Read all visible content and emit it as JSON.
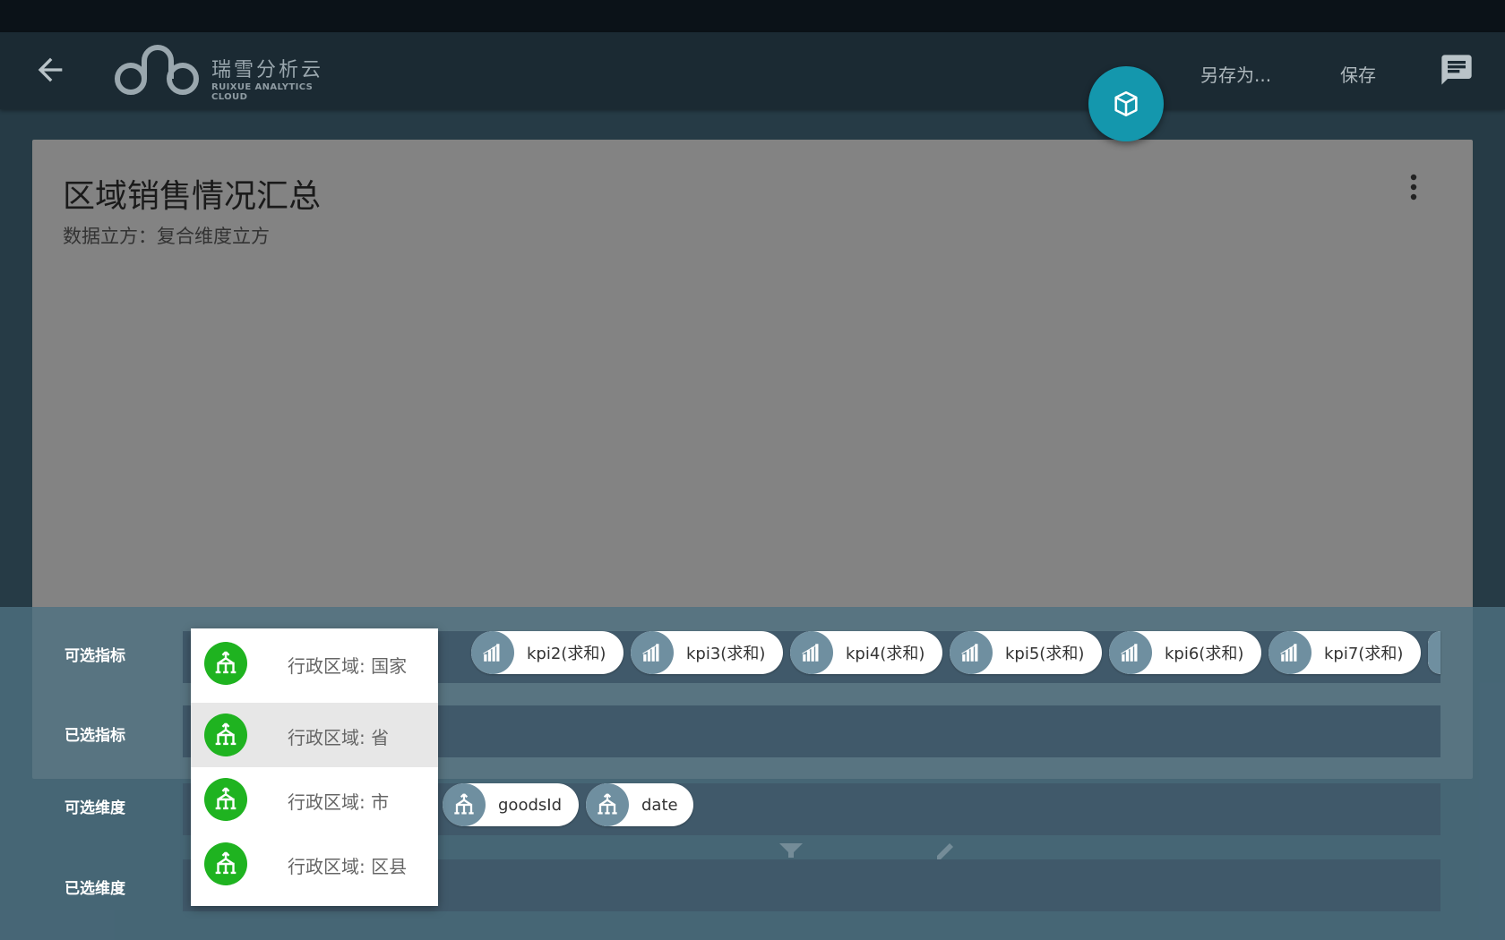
{
  "header": {
    "logo_cn": "瑞雪分析云",
    "logo_en": "RUIXUE ANALYTICS CLOUD",
    "save_as_label": "另存为...",
    "save_label": "保存",
    "back_icon": "arrow-left-icon",
    "chat_icon": "chat-icon",
    "fab_icon": "cube-icon"
  },
  "card": {
    "title": "区域销售情况汇总",
    "subtitle": "数据立方：复合维度立方"
  },
  "panel": {
    "labels": {
      "available_metrics": "可选指标",
      "selected_metrics": "已选指标",
      "available_dimensions": "可选维度",
      "selected_dimensions": "已选维度"
    },
    "metric_chips": [
      {
        "label": "kpi2(求和)"
      },
      {
        "label": "kpi3(求和)"
      },
      {
        "label": "kpi4(求和)"
      },
      {
        "label": "kpi5(求和)"
      },
      {
        "label": "kpi6(求和)"
      },
      {
        "label": "kpi7(求和)"
      }
    ],
    "dimension_chips": [
      {
        "label": "goodsId"
      },
      {
        "label": "date"
      }
    ]
  },
  "dropdown": {
    "items": [
      {
        "label": "行政区域: 国家"
      },
      {
        "label": "行政区域: 省",
        "highlighted": true
      },
      {
        "label": "行政区域: 市"
      },
      {
        "label": "行政区域: 区县"
      }
    ]
  },
  "colors": {
    "accent": "#1497ad",
    "dimension_green": "#1fb320",
    "chip_icon_bg": "#6f8fa0",
    "panel_bg": "#4e7080"
  }
}
